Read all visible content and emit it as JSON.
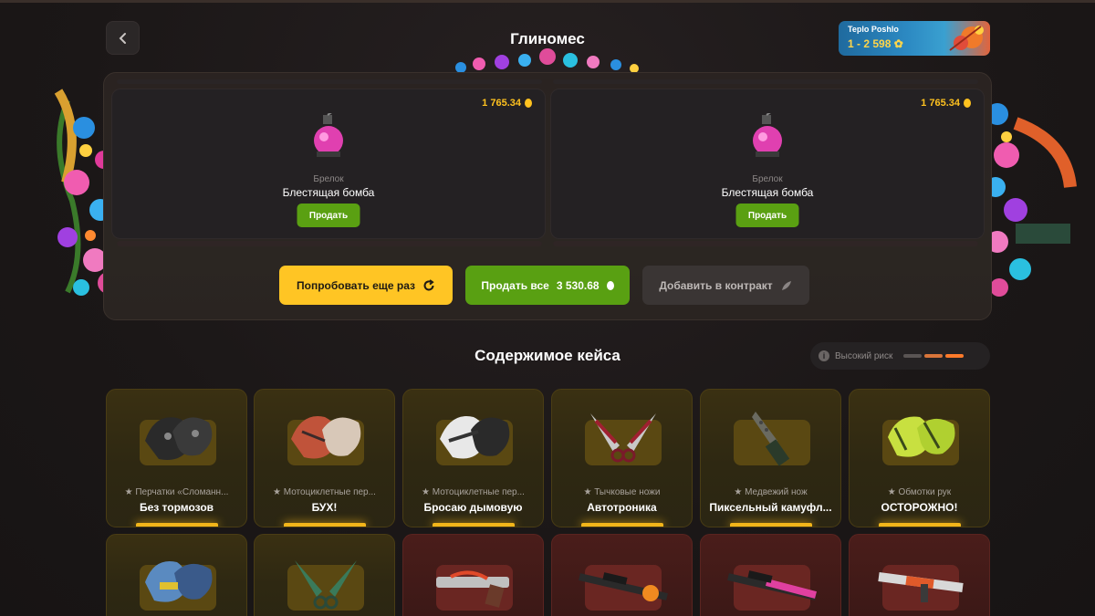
{
  "header": {
    "title": "Глиномес",
    "promo": {
      "name": "Teplo Poshlo",
      "value": "1 - 2 598"
    }
  },
  "result": {
    "items": [
      {
        "price": "1 765.34",
        "type": "Брелок",
        "name": "Блестящая бомба",
        "sell_label": "Продать"
      },
      {
        "price": "1 765.34",
        "type": "Брелок",
        "name": "Блестящая бомба",
        "sell_label": "Продать"
      }
    ],
    "actions": {
      "retry_label": "Попробовать еще раз",
      "sell_all_label": "Продать все",
      "sell_all_value": "3 530.68",
      "contract_label": "Добавить в контракт"
    }
  },
  "contents": {
    "title": "Содержимое кейса",
    "risk_label": "Высокий риск",
    "risk_colors": [
      "#5a5554",
      "#d9753a",
      "#ff7a2a"
    ],
    "items": [
      {
        "type": "★ Перчатки «Сломанн...",
        "name": "Без тормозов",
        "rarity": "gold",
        "icon": "gloves-black-icon"
      },
      {
        "type": "★ Мотоциклетные пер...",
        "name": "БУХ!",
        "rarity": "gold",
        "icon": "gloves-red-white-icon"
      },
      {
        "type": "★ Мотоциклетные пер...",
        "name": "Бросаю дымовую",
        "rarity": "gold",
        "icon": "gloves-black-white-icon"
      },
      {
        "type": "★ Тычковые ножи",
        "name": "Автотроника",
        "rarity": "gold",
        "icon": "push-knives-icon"
      },
      {
        "type": "★ Медвежий нож",
        "name": "Пиксельный камуфл...",
        "rarity": "gold",
        "icon": "bowie-knife-icon"
      },
      {
        "type": "★ Обмотки рук",
        "name": "ОСТОРОЖНО!",
        "rarity": "gold",
        "icon": "hand-wraps-icon"
      },
      {
        "type": "",
        "name": "",
        "rarity": "gold",
        "icon": "gloves-blue-icon"
      },
      {
        "type": "",
        "name": "",
        "rarity": "gold",
        "icon": "push-knives-green-icon"
      },
      {
        "type": "",
        "name": "",
        "rarity": "red",
        "icon": "pistol-icon"
      },
      {
        "type": "",
        "name": "",
        "rarity": "red",
        "icon": "awp-rifle-icon"
      },
      {
        "type": "",
        "name": "",
        "rarity": "red",
        "icon": "awp-rifle-pink-icon"
      },
      {
        "type": "",
        "name": "",
        "rarity": "red",
        "icon": "m4-rifle-icon"
      }
    ]
  },
  "colors": {
    "gold": "#ffc524",
    "green": "#59a012",
    "coin": "#ffc21f"
  }
}
